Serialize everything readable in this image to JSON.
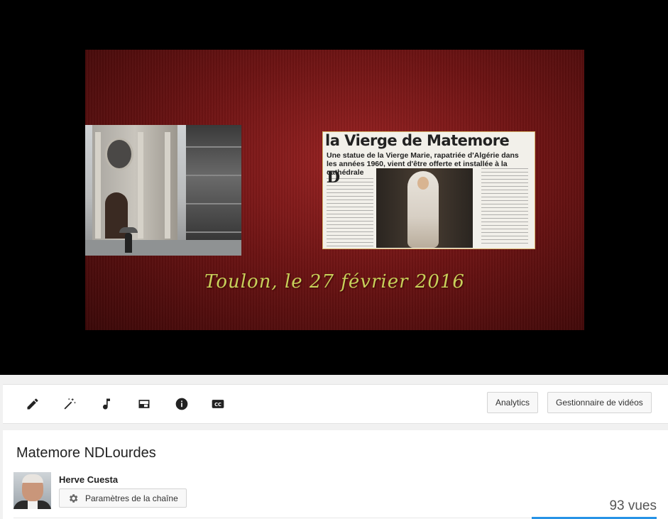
{
  "player": {
    "clipping_headline": "la Vierge de Matemore",
    "clipping_lead": "Une statue de la Vierge Marie, rapatriée d'Algérie dans les années 1960, vient d'être offerte et installée à la cathédrale",
    "clipping_dropcap": "D",
    "caption": "Toulon, le 27 février 2016"
  },
  "toolbar": {
    "tools": [
      {
        "name": "pencil-icon"
      },
      {
        "name": "magic-wand-icon"
      },
      {
        "name": "music-note-icon"
      },
      {
        "name": "end-screen-icon"
      },
      {
        "name": "info-icon"
      },
      {
        "name": "subtitles-icon"
      }
    ],
    "analytics_label": "Analytics",
    "video_manager_label": "Gestionnaire de vidéos"
  },
  "video": {
    "title": "Matemore NDLourdes",
    "channel_name": "Herve Cuesta",
    "channel_settings_label": "Paramètres de la chaîne",
    "views": "93 vues"
  },
  "colors": {
    "accent_blue": "#2793e6",
    "frame_red": "#8a1d1d",
    "caption_yellow": "#c8d05a"
  }
}
